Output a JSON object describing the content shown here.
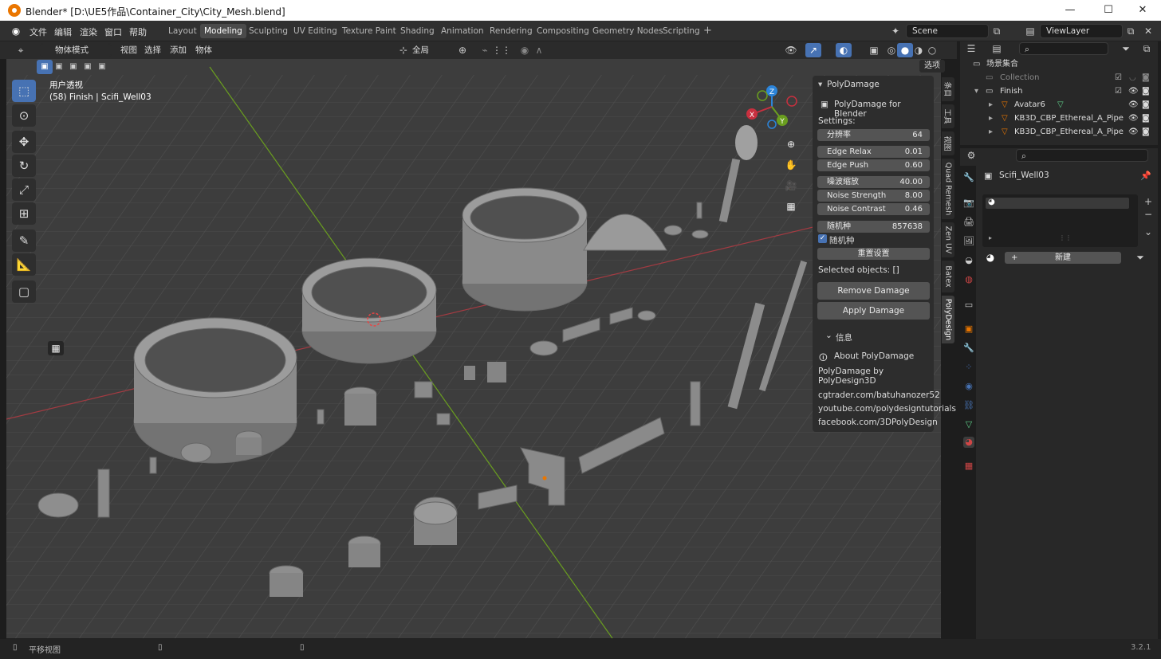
{
  "window": {
    "title": "Blender* [D:\\UE5作品\\Container_City\\City_Mesh.blend]",
    "minimize": "—",
    "maximize": "☐",
    "close": "✕"
  },
  "menubar": {
    "items": [
      "文件",
      "编辑",
      "渲染",
      "窗口",
      "帮助"
    ]
  },
  "workspaces": {
    "tabs": [
      "Layout",
      "Modeling",
      "Sculpting",
      "UV Editing",
      "Texture Paint",
      "Shading",
      "Animation",
      "Rendering",
      "Compositing",
      "Geometry Nodes",
      "Scripting"
    ],
    "active": "Modeling",
    "add": "+"
  },
  "scene": {
    "name": "Scene"
  },
  "viewlayer": {
    "name": "ViewLayer"
  },
  "header": {
    "mode": "物体模式",
    "menus": [
      "视图",
      "选择",
      "添加",
      "物体"
    ],
    "transform_orientation": "全局",
    "options": "选项"
  },
  "viewport": {
    "view_name": "用户透视",
    "object_info": "(58) Finish | Scifi_Well03",
    "gizmo": {
      "x": "X",
      "y": "Y",
      "z": "Z"
    }
  },
  "polydamage": {
    "panel_title": "PolyDamage",
    "subtitle": "PolyDamage for Blender",
    "settings_label": "Settings:",
    "fields": [
      {
        "label": "分辨率",
        "value": "64"
      },
      {
        "label": "Edge Relax",
        "value": "0.01"
      },
      {
        "label": "Edge Push",
        "value": "0.60"
      },
      {
        "label": "噪波缩放",
        "value": "40.00"
      },
      {
        "label": "Noise Strength",
        "value": "8.00"
      },
      {
        "label": "Noise Contrast",
        "value": "0.46"
      },
      {
        "label": "随机种",
        "value": "857638"
      }
    ],
    "random_checkbox": "随机种",
    "reset_button": "重置设置",
    "selected_objects": "Selected objects: []",
    "remove_button": "Remove Damage",
    "apply_button": "Apply Damage",
    "info_title": "信息",
    "about": "About PolyDamage",
    "by": "PolyDamage by PolyDesign3D",
    "links": [
      "cgtrader.com/batuhanozer52",
      "youtube.com/polydesigntutorials",
      "facebook.com/3DPolyDesign"
    ]
  },
  "sidebar_tabs": [
    "条目",
    "工具",
    "视图",
    "Quad Remesh",
    "Zen UV",
    "Batex",
    "PolyDesign"
  ],
  "outliner": {
    "root": "场景集合",
    "rows": [
      {
        "name": "Collection",
        "level": 1
      },
      {
        "name": "Finish",
        "level": 1
      },
      {
        "name": "Avatar6",
        "level": 2
      },
      {
        "name": "KB3D_CBP_Ethereal_A_Pipe",
        "level": 2
      },
      {
        "name": "KB3D_CBP_Ethereal_A_Pipe",
        "level": 2
      }
    ]
  },
  "properties": {
    "object_name": "Scifi_Well03",
    "new_button": "新建"
  },
  "statusbar": {
    "left": "平移视图",
    "version": "3.2.1"
  },
  "colors": {
    "accent": "#4772b3",
    "x_axis": "#c8303f",
    "y_axis": "#6a9e1f",
    "z_axis": "#2c84d9",
    "orange": "#ea7600"
  }
}
